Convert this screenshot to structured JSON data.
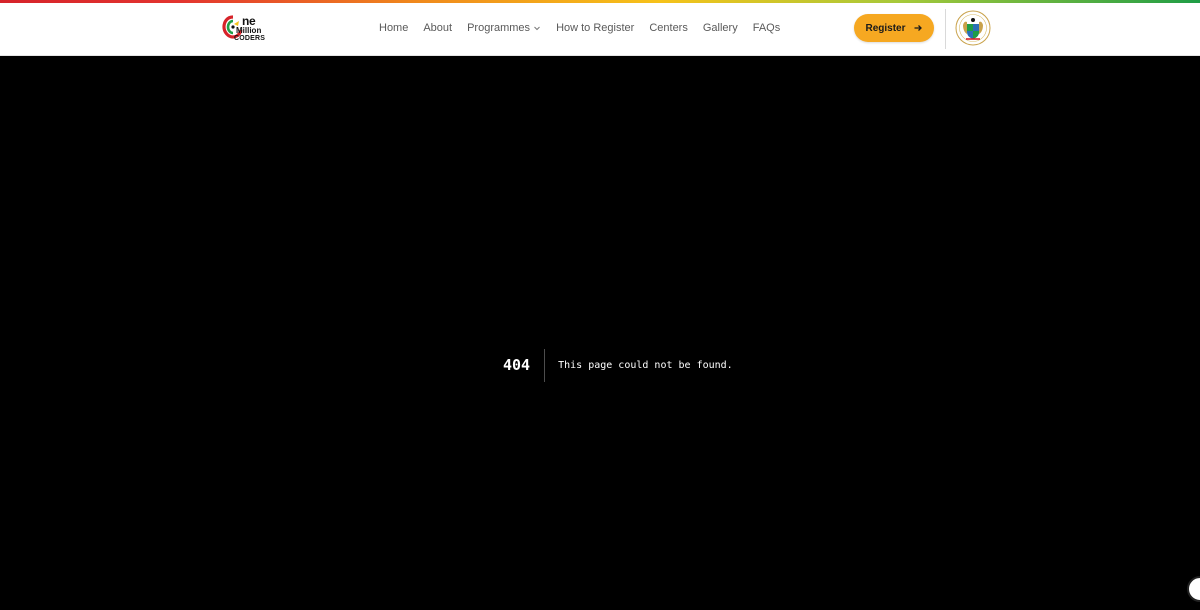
{
  "brand": {
    "logo_line1": "ne",
    "logo_line2": "Million",
    "logo_line3": "CODERS"
  },
  "nav": {
    "items": [
      "Home",
      "About",
      "Programmes",
      "How to Register",
      "Centers",
      "Gallery",
      "FAQs"
    ]
  },
  "header": {
    "register_label": "Register"
  },
  "error": {
    "code": "404",
    "message": "This page could not be found."
  },
  "colors": {
    "accent": "#f6a821",
    "background": "#000000",
    "header_bg": "#ffffff"
  },
  "icons": {
    "register": "arrow-right-icon",
    "dropdown": "chevron-down-icon",
    "emblem": "coat-of-arms-icon"
  }
}
